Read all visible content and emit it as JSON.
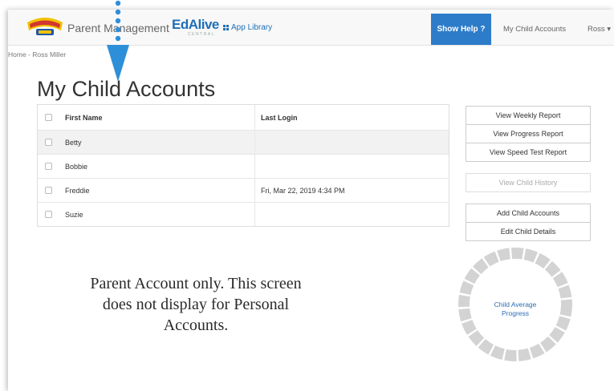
{
  "navbar": {
    "brand_title": "Parent Management",
    "edalive_name": "EdAlive",
    "edalive_sub": "CENTRAL",
    "app_library_label": "App Library",
    "show_help_label": "Show Help ?",
    "my_child_accounts_label": "My Child Accounts",
    "user_menu_label": "Ross ▾"
  },
  "breadcrumb": "Home - Ross Miller",
  "page_title": "My Child Accounts",
  "table": {
    "headers": [
      "First Name",
      "Last Login"
    ],
    "rows": [
      {
        "first_name": "Betty",
        "last_login": ""
      },
      {
        "first_name": "Bobbie",
        "last_login": ""
      },
      {
        "first_name": "Freddie",
        "last_login": "Fri, Mar 22, 2019 4:34 PM"
      },
      {
        "first_name": "Suzie",
        "last_login": ""
      }
    ]
  },
  "reports": [
    "View Weekly Report",
    "View Progress Report",
    "View Speed Test Report"
  ],
  "history_button": "View Child History",
  "account_actions": [
    "Add Child Accounts",
    "Edit Child Details"
  ],
  "progress_widget": {
    "label_line1": "Child Average",
    "label_line2": "Progress"
  },
  "note": {
    "line1": "Parent Account only. This screen",
    "line2": "does not display for Personal",
    "line3": "Accounts."
  },
  "colors": {
    "accent_blue": "#2d7cc9",
    "arrow_blue": "#2e8fd9",
    "ring_gray": "#d3d3d3"
  }
}
